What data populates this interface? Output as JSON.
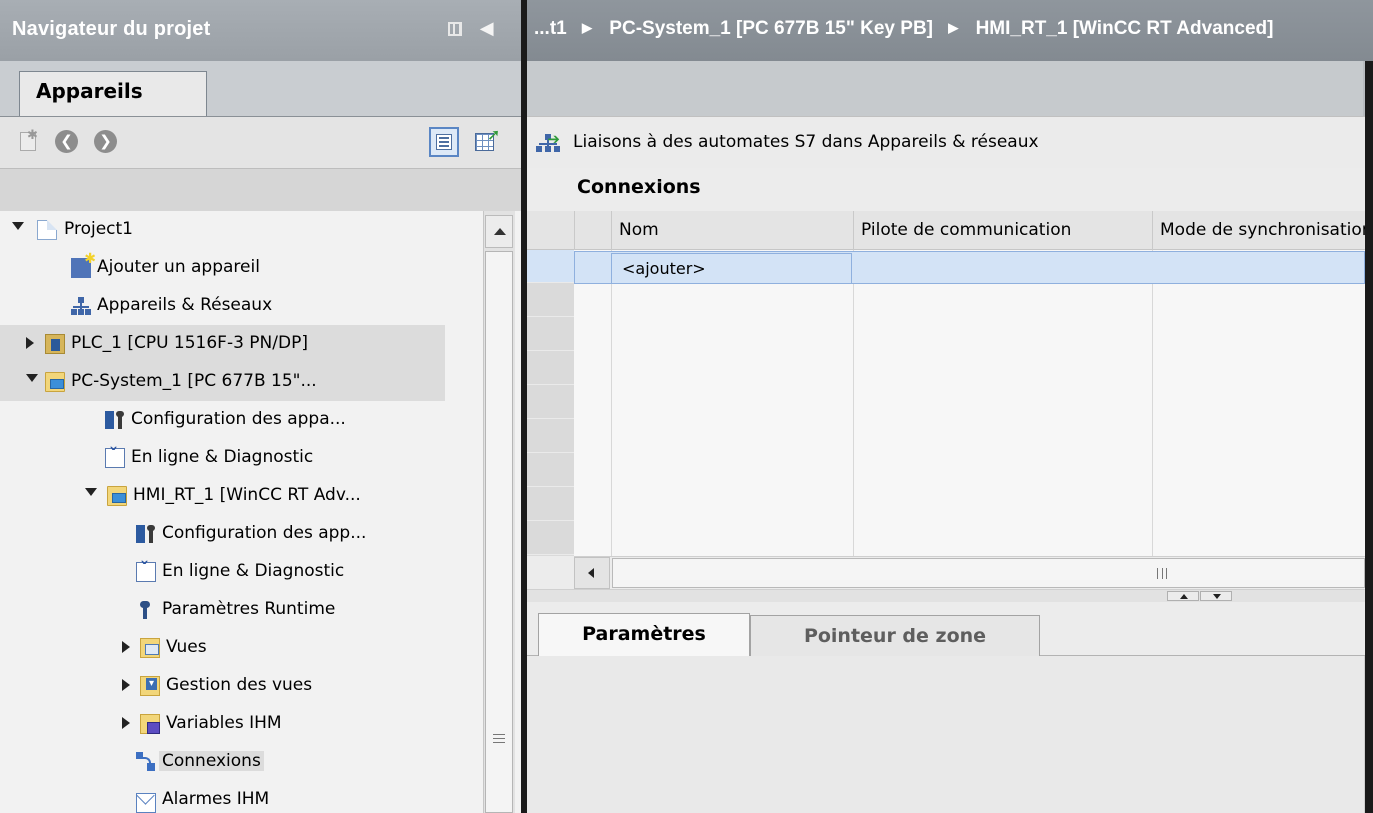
{
  "left_pane": {
    "title": "Navigateur du projet",
    "tab_label": "Appareils",
    "tree": [
      {
        "label": "Project1",
        "level": 0,
        "expander": "expanded",
        "icon": "project-page-icon"
      },
      {
        "label": "Ajouter un appareil",
        "level": 1,
        "expander": "none",
        "icon": "add-device-icon"
      },
      {
        "label": "Appareils & Réseaux",
        "level": 1,
        "expander": "none",
        "icon": "network-icon"
      },
      {
        "label": "PLC_1 [CPU 1516F-3 PN/DP]",
        "level": 1,
        "expander": "collapsed",
        "icon": "plc-icon",
        "selected": true
      },
      {
        "label": "PC-System_1 [PC 677B 15\"...",
        "level": 1,
        "expander": "expanded",
        "icon": "pc-system-icon",
        "selected": true
      },
      {
        "label": "Configuration des appa...",
        "level": 2,
        "expander": "none",
        "icon": "device-config-icon"
      },
      {
        "label": "En ligne & Diagnostic",
        "level": 2,
        "expander": "none",
        "icon": "online-diagnostic-icon"
      },
      {
        "label": "HMI_RT_1 [WinCC RT Adv...",
        "level": 2,
        "expander": "expanded",
        "icon": "hmi-runtime-icon"
      },
      {
        "label": "Configuration des app...",
        "level": 3,
        "expander": "none",
        "icon": "device-config-icon"
      },
      {
        "label": "En ligne & Diagnostic",
        "level": 3,
        "expander": "none",
        "icon": "online-diagnostic-icon"
      },
      {
        "label": "Paramètres Runtime",
        "level": 3,
        "expander": "none",
        "icon": "runtime-settings-icon"
      },
      {
        "label": "Vues",
        "level": 3,
        "expander": "collapsed",
        "icon": "screens-folder-icon"
      },
      {
        "label": "Gestion des vues",
        "level": 3,
        "expander": "collapsed",
        "icon": "screen-management-icon"
      },
      {
        "label": "Variables IHM",
        "level": 3,
        "expander": "collapsed",
        "icon": "hmi-tags-icon"
      },
      {
        "label": "Connexions",
        "level": 3,
        "expander": "none",
        "icon": "connections-icon",
        "highlighted": true
      },
      {
        "label": "Alarmes IHM",
        "level": 3,
        "expander": "none",
        "icon": "hmi-alarms-icon"
      }
    ]
  },
  "right_pane": {
    "breadcrumb": [
      "...t1",
      "PC-System_1 [PC 677B 15\" Key PB]",
      "HMI_RT_1 [WinCC RT Advanced]"
    ],
    "link_text": "Liaisons à des automates S7 dans Appareils & réseaux",
    "section_title": "Connexions",
    "columns": [
      "Nom",
      "Pilote de communication",
      "Mode de synchronisation"
    ],
    "add_placeholder": "<ajouter>",
    "bottom_tabs": [
      "Paramètres",
      "Pointeur de zone"
    ]
  }
}
